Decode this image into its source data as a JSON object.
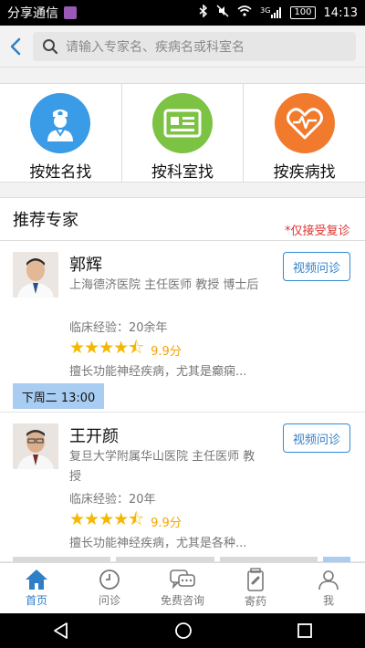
{
  "status_bar": {
    "carrier": "分享通信",
    "battery": "100",
    "network": "3G",
    "time": "14:13"
  },
  "search": {
    "placeholder": "请输入专家名、疾病名或科室名"
  },
  "categories": [
    {
      "label": "按姓名找",
      "icon": "doctor-icon",
      "color": "#3a9be6"
    },
    {
      "label": "按科室找",
      "icon": "id-card-icon",
      "color": "#7cc243"
    },
    {
      "label": "按疾病找",
      "icon": "heart-pulse-icon",
      "color": "#f17a2c"
    }
  ],
  "recommended": {
    "title": "推荐专家",
    "doctors": [
      {
        "name": "郭辉",
        "affiliation": "上海德济医院 主任医师 教授 博士后",
        "experience": "临床经验：20余年",
        "rating": 4.5,
        "score": "9.9分",
        "specialty": "擅长功能神经疾病，尤其是癫痫...",
        "video_button": "视频问诊",
        "schedule": "下周二 13:00"
      },
      {
        "name": "王开颜",
        "affiliation": "复旦大学附属华山医院 主任医师 教授",
        "experience": "临床经验：20年",
        "rating": 4.5,
        "score": "9.9分",
        "specialty": "擅长功能神经疾病，尤其是各种...",
        "video_button": "视频问诊",
        "note": "*仅接受复诊"
      }
    ]
  },
  "tabs": [
    {
      "label": "首页",
      "icon": "home-icon",
      "active": true
    },
    {
      "label": "问诊",
      "icon": "clock-icon",
      "active": false
    },
    {
      "label": "免费咨询",
      "icon": "chat-icon",
      "active": false
    },
    {
      "label": "寄药",
      "icon": "medicine-icon",
      "active": false
    },
    {
      "label": "我",
      "icon": "person-icon",
      "active": false
    }
  ],
  "colors": {
    "accent": "#2f7fc8",
    "star": "#f5b800",
    "note_red": "#e03030",
    "schedule_bg": "#a9cdf2"
  }
}
